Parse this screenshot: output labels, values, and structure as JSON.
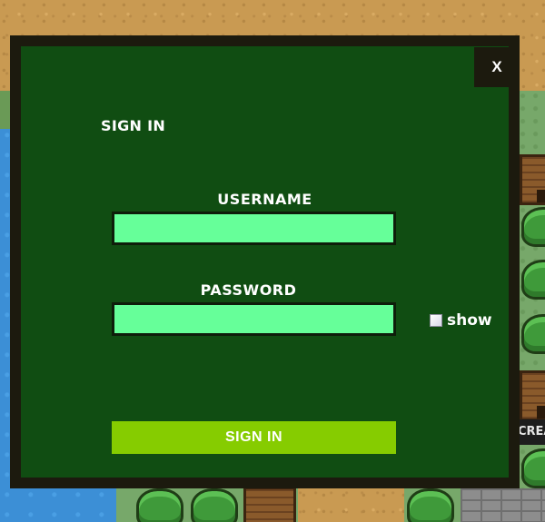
{
  "modal": {
    "close_label": "X",
    "title": "SIGN IN",
    "username": {
      "label": "USERNAME",
      "value": "",
      "placeholder": ""
    },
    "password": {
      "label": "PASSWORD",
      "value": "",
      "placeholder": ""
    },
    "show_password": {
      "label": "show",
      "checked": false
    },
    "submit_label": "SIGN IN"
  },
  "background": {
    "sign_text": "CREA"
  },
  "colors": {
    "modal_bg": "#104d12",
    "modal_border": "#1c1a0e",
    "input_bg": "#66ff99",
    "submit_bg": "#86cc00",
    "text": "#ffffff"
  }
}
